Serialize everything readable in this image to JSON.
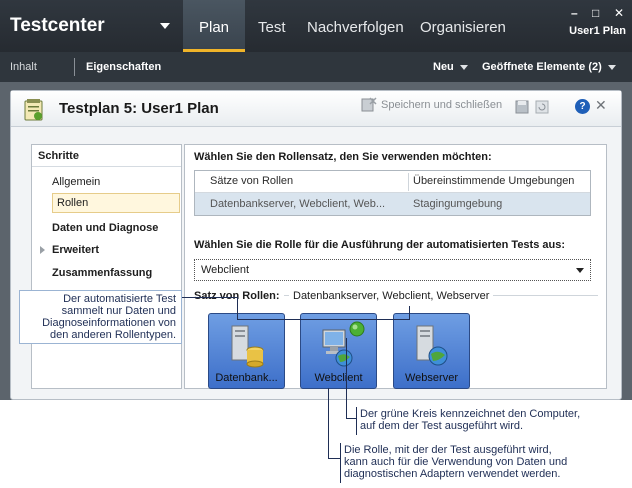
{
  "topbar": {
    "brand": "Testcenter",
    "tabs": [
      {
        "label": "Plan",
        "active": true
      },
      {
        "label": "Test"
      },
      {
        "label": "Nachverfolgen"
      },
      {
        "label": "Organisieren"
      }
    ],
    "window_controls": [
      "–",
      "□",
      "✕"
    ],
    "user": "User1 Plan",
    "accent_color": "#f0b429"
  },
  "subbar": {
    "left_items": [
      "Inhalt",
      "Eigenschaften"
    ],
    "new_label": "Neu",
    "open_items_label": "Geöffnete Elemente (2)"
  },
  "panel": {
    "title": "Testplan 5: User1 Plan",
    "save_close": "Speichern und schließen",
    "help": "?",
    "close": "✕"
  },
  "steps": {
    "title": "Schritte",
    "items": [
      "Allgemein",
      "Rollen",
      "Daten und Diagnose",
      "Erweitert",
      "Zusammenfassung"
    ]
  },
  "content": {
    "roleset_prompt": "Wählen Sie den Rollensatz, den Sie verwenden möchten:",
    "grid_headers": [
      "Sätze von Rollen",
      "Übereinstimmende Umgebungen"
    ],
    "grid_row": [
      "Datenbankserver, Webclient, Web...",
      "Stagingumgebung"
    ],
    "role_prompt": "Wählen Sie die Rolle für die Ausführung der automatisierten Tests aus:",
    "role_selected": "Webclient",
    "satz_label": "Satz von Rollen:",
    "satz_value": "Datenbankserver, Webclient, Webserver",
    "roles": [
      "Datenbank...",
      "Webclient",
      "Webserver"
    ]
  },
  "callouts": {
    "left": [
      "Der automatisierte Test",
      "sammelt nur Daten und",
      "Diagnoseinformationen von",
      "den anderen Rollentypen."
    ],
    "green": [
      "Der grüne Kreis kennzeichnet den Computer,",
      "auf dem der Test ausgeführt wird."
    ],
    "role": [
      "Die Rolle, mit der der Test ausgeführt wird,",
      "kann auch für die Verwendung von Daten und",
      "diagnostischen Adaptern verwendet werden."
    ]
  }
}
